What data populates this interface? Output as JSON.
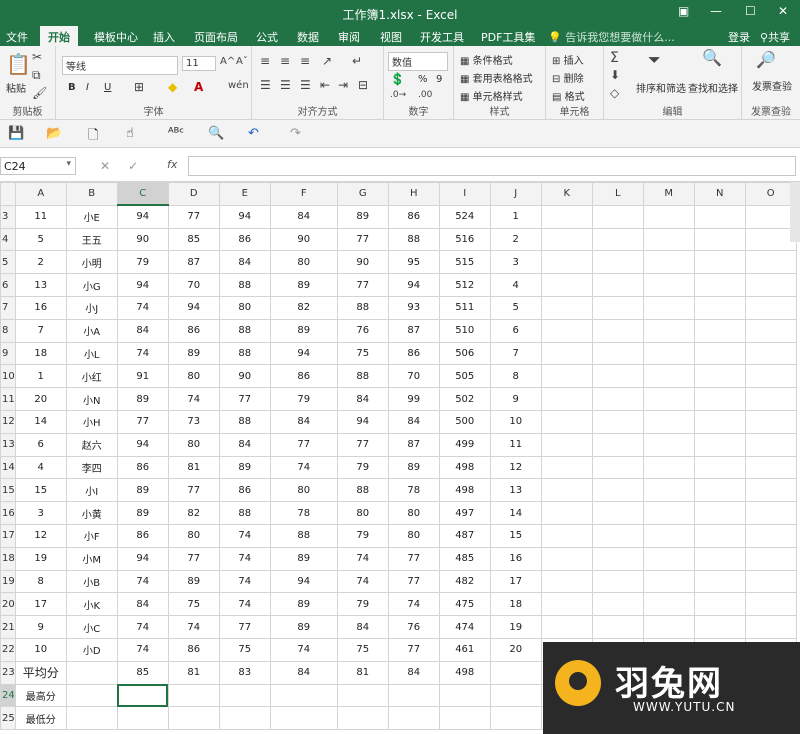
{
  "window": {
    "title": "工作簿1.xlsx - Excel",
    "login": "登录",
    "share": "共享"
  },
  "tabs": [
    "文件",
    "开始",
    "模板中心",
    "插入",
    "页面布局",
    "公式",
    "数据",
    "审阅",
    "视图",
    "开发工具",
    "PDF工具集"
  ],
  "active_tab": "开始",
  "tell_me": "告诉我您想要做什么...",
  "ribbon": {
    "clipboard": {
      "paste": "粘贴",
      "label": "剪贴板"
    },
    "font": {
      "name": "等线",
      "size": "11",
      "label": "字体",
      "bold": "B",
      "italic": "I",
      "underline": "U"
    },
    "align": {
      "label": "对齐方式"
    },
    "number": {
      "format": "数值",
      "percent": "%",
      "comma": "9",
      "label": "数字"
    },
    "styles": {
      "conditional": "条件格式",
      "table": "套用表格格式",
      "cell": "单元格样式",
      "label": "样式"
    },
    "cells": {
      "insert": "插入",
      "delete": "删除",
      "format": "格式",
      "label": "单元格"
    },
    "editing": {
      "sort": "排序和筛选",
      "find": "查找和选择",
      "label": "编辑"
    },
    "invoice": {
      "check": "发票查验",
      "label": "发票查验"
    }
  },
  "formula_bar": {
    "name_box": "C24",
    "fx": "fx",
    "value": ""
  },
  "columns": [
    "A",
    "B",
    "C",
    "D",
    "E",
    "F",
    "G",
    "H",
    "I",
    "J",
    "K",
    "L",
    "M",
    "N",
    "O"
  ],
  "selected_col": "C",
  "selected_row": "24",
  "rows": [
    {
      "n": "3",
      "cells": [
        "11",
        "小E",
        "94",
        "77",
        "94",
        "84",
        "89",
        "86",
        "524",
        "1"
      ]
    },
    {
      "n": "4",
      "cells": [
        "5",
        "王五",
        "90",
        "85",
        "86",
        "90",
        "77",
        "88",
        "516",
        "2"
      ]
    },
    {
      "n": "5",
      "cells": [
        "2",
        "小明",
        "79",
        "87",
        "84",
        "80",
        "90",
        "95",
        "515",
        "3"
      ]
    },
    {
      "n": "6",
      "cells": [
        "13",
        "小G",
        "94",
        "70",
        "88",
        "89",
        "77",
        "94",
        "512",
        "4"
      ]
    },
    {
      "n": "7",
      "cells": [
        "16",
        "小J",
        "74",
        "94",
        "80",
        "82",
        "88",
        "93",
        "511",
        "5"
      ]
    },
    {
      "n": "8",
      "cells": [
        "7",
        "小A",
        "84",
        "86",
        "88",
        "89",
        "76",
        "87",
        "510",
        "6"
      ]
    },
    {
      "n": "9",
      "cells": [
        "18",
        "小L",
        "74",
        "89",
        "88",
        "94",
        "75",
        "86",
        "506",
        "7"
      ]
    },
    {
      "n": "10",
      "cells": [
        "1",
        "小红",
        "91",
        "80",
        "90",
        "86",
        "88",
        "70",
        "505",
        "8"
      ]
    },
    {
      "n": "11",
      "cells": [
        "20",
        "小N",
        "89",
        "74",
        "77",
        "79",
        "84",
        "99",
        "502",
        "9"
      ]
    },
    {
      "n": "12",
      "cells": [
        "14",
        "小H",
        "77",
        "73",
        "88",
        "84",
        "94",
        "84",
        "500",
        "10"
      ]
    },
    {
      "n": "13",
      "cells": [
        "6",
        "赵六",
        "94",
        "80",
        "84",
        "77",
        "77",
        "87",
        "499",
        "11"
      ]
    },
    {
      "n": "14",
      "cells": [
        "4",
        "李四",
        "86",
        "81",
        "89",
        "74",
        "79",
        "89",
        "498",
        "12"
      ]
    },
    {
      "n": "15",
      "cells": [
        "15",
        "小I",
        "89",
        "77",
        "86",
        "80",
        "88",
        "78",
        "498",
        "13"
      ]
    },
    {
      "n": "16",
      "cells": [
        "3",
        "小黄",
        "89",
        "82",
        "88",
        "78",
        "80",
        "80",
        "497",
        "14"
      ]
    },
    {
      "n": "17",
      "cells": [
        "12",
        "小F",
        "86",
        "80",
        "74",
        "88",
        "79",
        "80",
        "487",
        "15"
      ]
    },
    {
      "n": "18",
      "cells": [
        "19",
        "小M",
        "94",
        "77",
        "74",
        "89",
        "74",
        "77",
        "485",
        "16"
      ]
    },
    {
      "n": "19",
      "cells": [
        "8",
        "小B",
        "74",
        "89",
        "74",
        "94",
        "74",
        "77",
        "482",
        "17"
      ]
    },
    {
      "n": "20",
      "cells": [
        "17",
        "小K",
        "84",
        "75",
        "74",
        "89",
        "79",
        "74",
        "475",
        "18"
      ]
    },
    {
      "n": "21",
      "cells": [
        "9",
        "小C",
        "74",
        "74",
        "77",
        "89",
        "84",
        "76",
        "474",
        "19"
      ]
    },
    {
      "n": "22",
      "cells": [
        "10",
        "小D",
        "74",
        "86",
        "75",
        "74",
        "75",
        "77",
        "461",
        "20"
      ]
    }
  ],
  "summary": {
    "avg_label": "平均分",
    "avg_values": [
      "85",
      "81",
      "83",
      "84",
      "81",
      "84",
      "498"
    ],
    "max_label": "最高分",
    "min_label": "最低分"
  },
  "watermark": {
    "brand": "羽兔网",
    "url": "WWW.YUTU.CN"
  }
}
